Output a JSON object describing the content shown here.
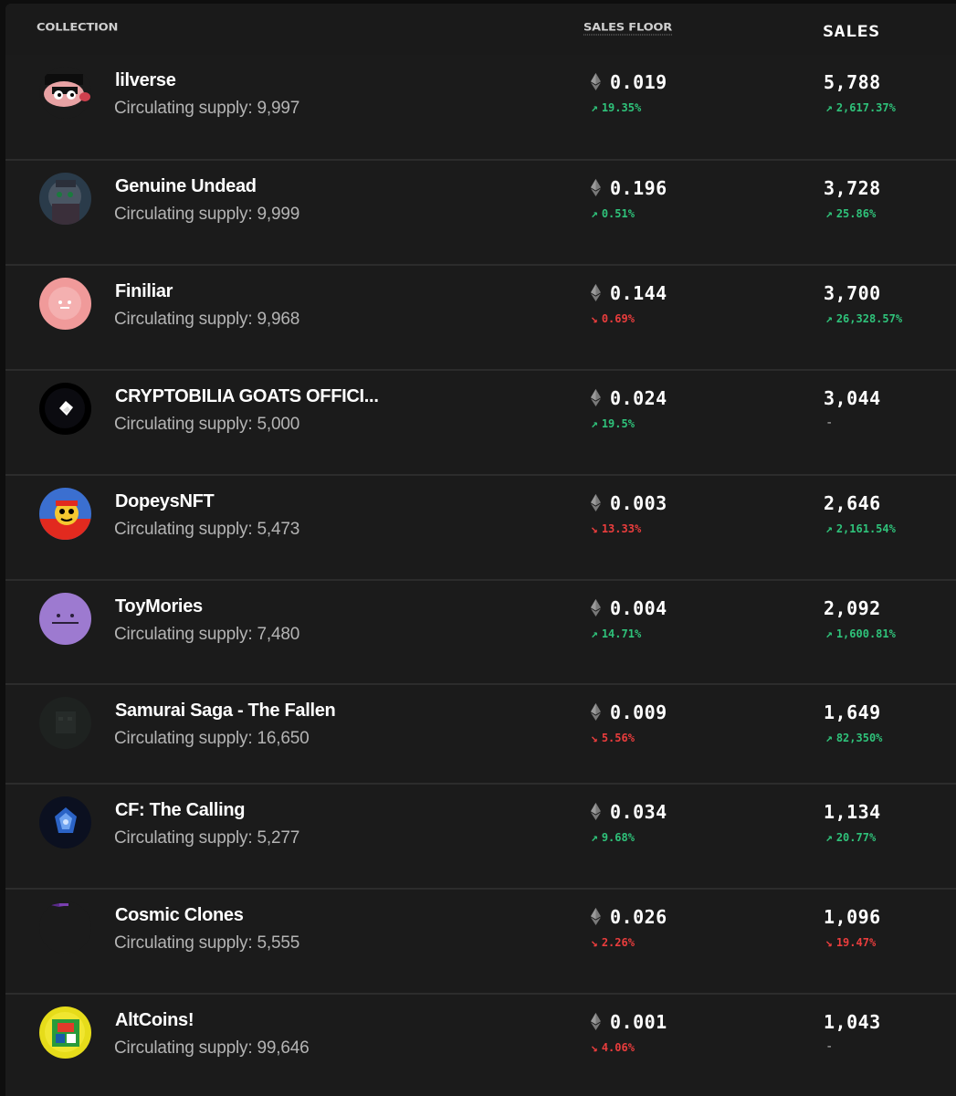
{
  "header": {
    "collection": "COLLECTION",
    "sales_floor": "SALES FLOOR",
    "sales": "SALES"
  },
  "icons": {
    "currency": "ethereum-icon",
    "up": "arrow-up-right-icon",
    "down": "arrow-down-right-icon"
  },
  "colors": {
    "background": "#1b1b1b",
    "divider": "#2c2c2c",
    "positive": "#2fc27a",
    "negative": "#ea3d3d",
    "muted_text": "#b4b4b4"
  },
  "rows": [
    {
      "name": "lilverse",
      "supply": "Circulating supply: 9,997",
      "floor": "0.019",
      "floor_change": "19.35%",
      "floor_dir": "up",
      "sales": "5,788",
      "sales_change": "2,617.37%",
      "sales_dir": "up"
    },
    {
      "name": "Genuine Undead",
      "supply": "Circulating supply: 9,999",
      "floor": "0.196",
      "floor_change": "0.51%",
      "floor_dir": "up",
      "sales": "3,728",
      "sales_change": "25.86%",
      "sales_dir": "up"
    },
    {
      "name": "Finiliar",
      "supply": "Circulating supply: 9,968",
      "floor": "0.144",
      "floor_change": "0.69%",
      "floor_dir": "down",
      "sales": "3,700",
      "sales_change": "26,328.57%",
      "sales_dir": "up"
    },
    {
      "name": "CRYPTOBILIA GOATS OFFICI...",
      "supply": "Circulating supply: 5,000",
      "floor": "0.024",
      "floor_change": "19.5%",
      "floor_dir": "up",
      "sales": "3,044",
      "sales_change": "-",
      "sales_dir": "neutral"
    },
    {
      "name": "DopeysNFT",
      "supply": "Circulating supply: 5,473",
      "floor": "0.003",
      "floor_change": "13.33%",
      "floor_dir": "down",
      "sales": "2,646",
      "sales_change": "2,161.54%",
      "sales_dir": "up"
    },
    {
      "name": "ToyMories",
      "supply": "Circulating supply: 7,480",
      "floor": "0.004",
      "floor_change": "14.71%",
      "floor_dir": "up",
      "sales": "2,092",
      "sales_change": "1,600.81%",
      "sales_dir": "up"
    },
    {
      "name": "Samurai Saga - The Fallen",
      "supply": "Circulating supply: 16,650",
      "floor": "0.009",
      "floor_change": "5.56%",
      "floor_dir": "down",
      "sales": "1,649",
      "sales_change": "82,350%",
      "sales_dir": "up"
    },
    {
      "name": "CF: The Calling",
      "supply": "Circulating supply: 5,277",
      "floor": "0.034",
      "floor_change": "9.68%",
      "floor_dir": "up",
      "sales": "1,134",
      "sales_change": "20.77%",
      "sales_dir": "up"
    },
    {
      "name": "Cosmic Clones",
      "supply": "Circulating supply: 5,555",
      "floor": "0.026",
      "floor_change": "2.26%",
      "floor_dir": "down",
      "sales": "1,096",
      "sales_change": "19.47%",
      "sales_dir": "down"
    },
    {
      "name": "AltCoins!",
      "supply": "Circulating supply: 99,646",
      "floor": "0.001",
      "floor_change": "4.06%",
      "floor_dir": "down",
      "sales": "1,043",
      "sales_change": "-",
      "sales_dir": "neutral"
    }
  ]
}
